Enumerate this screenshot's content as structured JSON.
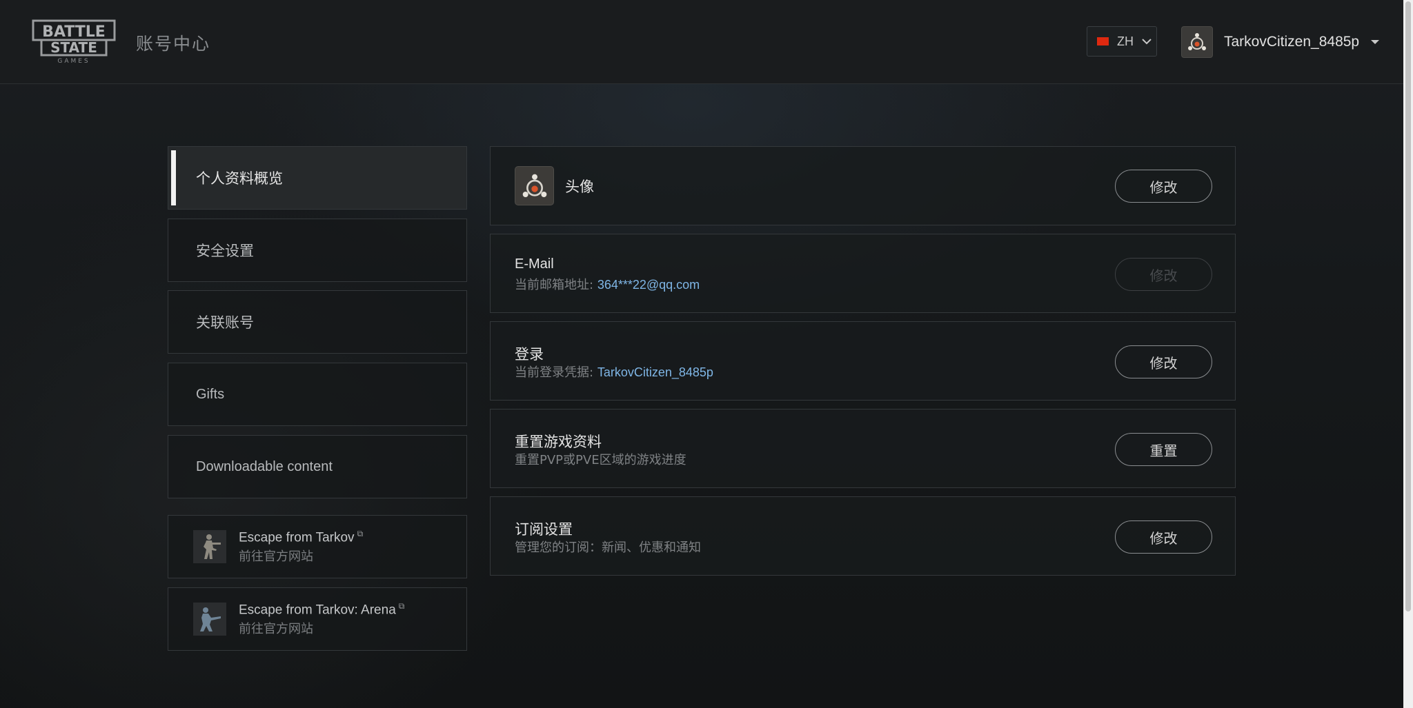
{
  "header": {
    "logo_text": "BATTLESTATE GAMES",
    "title": "账号中心",
    "language": "ZH",
    "username": "TarkovCitizen_8485p"
  },
  "sidebar": {
    "items": [
      {
        "label": "个人资料概览",
        "active": true
      },
      {
        "label": "安全设置"
      },
      {
        "label": "关联账号"
      },
      {
        "label": "Gifts"
      },
      {
        "label": "Downloadable content"
      }
    ],
    "games": [
      {
        "name": "Escape from Tarkov",
        "sub": "前往官方网站"
      },
      {
        "name": "Escape from Tarkov: Arena",
        "sub": "前往官方网站"
      }
    ]
  },
  "cards": {
    "avatar": {
      "title": "头像",
      "button": "修改"
    },
    "email": {
      "title": "E-Mail",
      "sub_label": "当前邮箱地址:",
      "value": "364***22@qq.com",
      "button": "修改"
    },
    "login": {
      "title": "登录",
      "sub_label": "当前登录凭据:",
      "value": "TarkovCitizen_8485p",
      "button": "修改"
    },
    "reset": {
      "title": "重置游戏资料",
      "sub": "重置PVP或PVE区域的游戏进度",
      "button": "重置"
    },
    "subscription": {
      "title": "订阅设置",
      "sub": "管理您的订阅：新闻、优惠和通知",
      "button": "修改"
    }
  },
  "colors": {
    "accent_link": "#7fb6e6",
    "flag_red": "#de2910"
  }
}
